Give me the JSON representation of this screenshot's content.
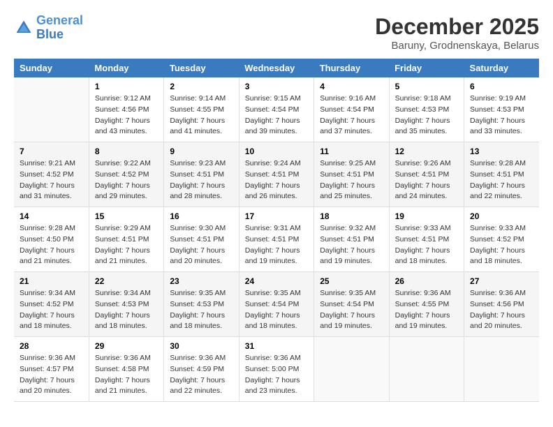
{
  "header": {
    "logo_line1": "General",
    "logo_line2": "Blue",
    "month_year": "December 2025",
    "location": "Baruny, Grodnenskaya, Belarus"
  },
  "days_of_week": [
    "Sunday",
    "Monday",
    "Tuesday",
    "Wednesday",
    "Thursday",
    "Friday",
    "Saturday"
  ],
  "weeks": [
    [
      {
        "day": "",
        "sunrise": "",
        "sunset": "",
        "daylight": ""
      },
      {
        "day": "1",
        "sunrise": "Sunrise: 9:12 AM",
        "sunset": "Sunset: 4:56 PM",
        "daylight": "Daylight: 7 hours and 43 minutes."
      },
      {
        "day": "2",
        "sunrise": "Sunrise: 9:14 AM",
        "sunset": "Sunset: 4:55 PM",
        "daylight": "Daylight: 7 hours and 41 minutes."
      },
      {
        "day": "3",
        "sunrise": "Sunrise: 9:15 AM",
        "sunset": "Sunset: 4:54 PM",
        "daylight": "Daylight: 7 hours and 39 minutes."
      },
      {
        "day": "4",
        "sunrise": "Sunrise: 9:16 AM",
        "sunset": "Sunset: 4:54 PM",
        "daylight": "Daylight: 7 hours and 37 minutes."
      },
      {
        "day": "5",
        "sunrise": "Sunrise: 9:18 AM",
        "sunset": "Sunset: 4:53 PM",
        "daylight": "Daylight: 7 hours and 35 minutes."
      },
      {
        "day": "6",
        "sunrise": "Sunrise: 9:19 AM",
        "sunset": "Sunset: 4:53 PM",
        "daylight": "Daylight: 7 hours and 33 minutes."
      }
    ],
    [
      {
        "day": "7",
        "sunrise": "Sunrise: 9:21 AM",
        "sunset": "Sunset: 4:52 PM",
        "daylight": "Daylight: 7 hours and 31 minutes."
      },
      {
        "day": "8",
        "sunrise": "Sunrise: 9:22 AM",
        "sunset": "Sunset: 4:52 PM",
        "daylight": "Daylight: 7 hours and 29 minutes."
      },
      {
        "day": "9",
        "sunrise": "Sunrise: 9:23 AM",
        "sunset": "Sunset: 4:51 PM",
        "daylight": "Daylight: 7 hours and 28 minutes."
      },
      {
        "day": "10",
        "sunrise": "Sunrise: 9:24 AM",
        "sunset": "Sunset: 4:51 PM",
        "daylight": "Daylight: 7 hours and 26 minutes."
      },
      {
        "day": "11",
        "sunrise": "Sunrise: 9:25 AM",
        "sunset": "Sunset: 4:51 PM",
        "daylight": "Daylight: 7 hours and 25 minutes."
      },
      {
        "day": "12",
        "sunrise": "Sunrise: 9:26 AM",
        "sunset": "Sunset: 4:51 PM",
        "daylight": "Daylight: 7 hours and 24 minutes."
      },
      {
        "day": "13",
        "sunrise": "Sunrise: 9:28 AM",
        "sunset": "Sunset: 4:51 PM",
        "daylight": "Daylight: 7 hours and 22 minutes."
      }
    ],
    [
      {
        "day": "14",
        "sunrise": "Sunrise: 9:28 AM",
        "sunset": "Sunset: 4:50 PM",
        "daylight": "Daylight: 7 hours and 21 minutes."
      },
      {
        "day": "15",
        "sunrise": "Sunrise: 9:29 AM",
        "sunset": "Sunset: 4:51 PM",
        "daylight": "Daylight: 7 hours and 21 minutes."
      },
      {
        "day": "16",
        "sunrise": "Sunrise: 9:30 AM",
        "sunset": "Sunset: 4:51 PM",
        "daylight": "Daylight: 7 hours and 20 minutes."
      },
      {
        "day": "17",
        "sunrise": "Sunrise: 9:31 AM",
        "sunset": "Sunset: 4:51 PM",
        "daylight": "Daylight: 7 hours and 19 minutes."
      },
      {
        "day": "18",
        "sunrise": "Sunrise: 9:32 AM",
        "sunset": "Sunset: 4:51 PM",
        "daylight": "Daylight: 7 hours and 19 minutes."
      },
      {
        "day": "19",
        "sunrise": "Sunrise: 9:33 AM",
        "sunset": "Sunset: 4:51 PM",
        "daylight": "Daylight: 7 hours and 18 minutes."
      },
      {
        "day": "20",
        "sunrise": "Sunrise: 9:33 AM",
        "sunset": "Sunset: 4:52 PM",
        "daylight": "Daylight: 7 hours and 18 minutes."
      }
    ],
    [
      {
        "day": "21",
        "sunrise": "Sunrise: 9:34 AM",
        "sunset": "Sunset: 4:52 PM",
        "daylight": "Daylight: 7 hours and 18 minutes."
      },
      {
        "day": "22",
        "sunrise": "Sunrise: 9:34 AM",
        "sunset": "Sunset: 4:53 PM",
        "daylight": "Daylight: 7 hours and 18 minutes."
      },
      {
        "day": "23",
        "sunrise": "Sunrise: 9:35 AM",
        "sunset": "Sunset: 4:53 PM",
        "daylight": "Daylight: 7 hours and 18 minutes."
      },
      {
        "day": "24",
        "sunrise": "Sunrise: 9:35 AM",
        "sunset": "Sunset: 4:54 PM",
        "daylight": "Daylight: 7 hours and 18 minutes."
      },
      {
        "day": "25",
        "sunrise": "Sunrise: 9:35 AM",
        "sunset": "Sunset: 4:54 PM",
        "daylight": "Daylight: 7 hours and 19 minutes."
      },
      {
        "day": "26",
        "sunrise": "Sunrise: 9:36 AM",
        "sunset": "Sunset: 4:55 PM",
        "daylight": "Daylight: 7 hours and 19 minutes."
      },
      {
        "day": "27",
        "sunrise": "Sunrise: 9:36 AM",
        "sunset": "Sunset: 4:56 PM",
        "daylight": "Daylight: 7 hours and 20 minutes."
      }
    ],
    [
      {
        "day": "28",
        "sunrise": "Sunrise: 9:36 AM",
        "sunset": "Sunset: 4:57 PM",
        "daylight": "Daylight: 7 hours and 20 minutes."
      },
      {
        "day": "29",
        "sunrise": "Sunrise: 9:36 AM",
        "sunset": "Sunset: 4:58 PM",
        "daylight": "Daylight: 7 hours and 21 minutes."
      },
      {
        "day": "30",
        "sunrise": "Sunrise: 9:36 AM",
        "sunset": "Sunset: 4:59 PM",
        "daylight": "Daylight: 7 hours and 22 minutes."
      },
      {
        "day": "31",
        "sunrise": "Sunrise: 9:36 AM",
        "sunset": "Sunset: 5:00 PM",
        "daylight": "Daylight: 7 hours and 23 minutes."
      },
      {
        "day": "",
        "sunrise": "",
        "sunset": "",
        "daylight": ""
      },
      {
        "day": "",
        "sunrise": "",
        "sunset": "",
        "daylight": ""
      },
      {
        "day": "",
        "sunrise": "",
        "sunset": "",
        "daylight": ""
      }
    ]
  ]
}
